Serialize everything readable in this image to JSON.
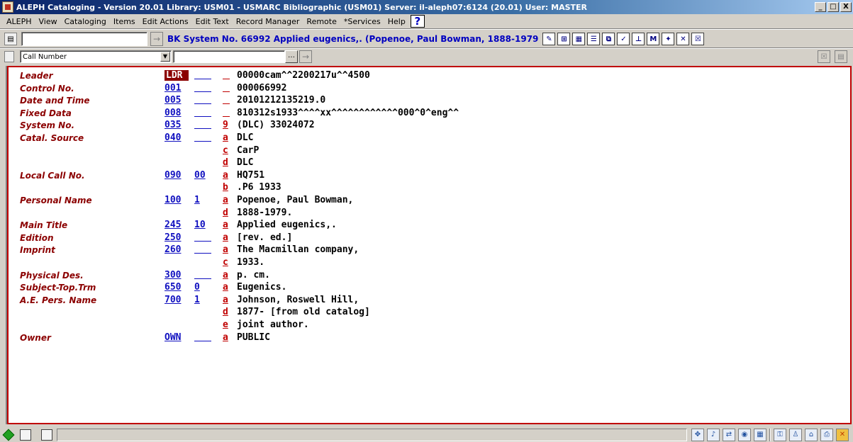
{
  "window": {
    "title": "ALEPH Cataloging - Version 20.01  Library: USM01 - USMARC Bibliographic (USM01)  Server: il-aleph07:6124 (20.01)  User: MASTER",
    "controls": [
      "_",
      "□",
      "X"
    ]
  },
  "menu": [
    "ALEPH",
    "View",
    "Cataloging",
    "Items",
    "Edit Actions",
    "Edit Text",
    "Record Manager",
    "Remote",
    "*Services",
    "Help"
  ],
  "toolbar": {
    "doc_input_value": "",
    "doc_info": "BK System No. 66992 Applied eugenics,. (Popenoe, Paul Bowman, 1888-1979"
  },
  "search": {
    "index_selected": "Call Number",
    "search_value": ""
  },
  "record": [
    {
      "label": "Leader",
      "tag": "LDR",
      "ind": "",
      "sub": "",
      "value": "00000cam^^2200217u^^4500",
      "selected": true
    },
    {
      "label": "Control No.",
      "tag": "001",
      "ind": "",
      "sub": "",
      "value": "000066992"
    },
    {
      "label": "Date and Time",
      "tag": "005",
      "ind": "",
      "sub": "",
      "value": "20101212135219.0"
    },
    {
      "label": "Fixed Data",
      "tag": "008",
      "ind": "",
      "sub": "",
      "value": "810312s1933^^^^xx^^^^^^^^^^^^000^0^eng^^"
    },
    {
      "label": "System No.",
      "tag": "035",
      "ind": "",
      "sub": "9",
      "value": "(DLC) 33024072"
    },
    {
      "label": "Catal. Source",
      "tag": "040",
      "ind": "",
      "sub": "a",
      "value": "DLC"
    },
    {
      "label": "",
      "tag": "",
      "ind": "",
      "sub": "c",
      "value": "CarP"
    },
    {
      "label": "",
      "tag": "",
      "ind": "",
      "sub": "d",
      "value": "DLC"
    },
    {
      "label": "Local Call No.",
      "tag": "090",
      "ind": "00",
      "sub": "a",
      "value": "HQ751"
    },
    {
      "label": "",
      "tag": "",
      "ind": "",
      "sub": "b",
      "value": ".P6 1933"
    },
    {
      "label": "Personal Name",
      "tag": "100",
      "ind": "1",
      "sub": "a",
      "value": "Popenoe, Paul Bowman,"
    },
    {
      "label": "",
      "tag": "",
      "ind": "",
      "sub": "d",
      "value": "1888-1979."
    },
    {
      "label": "Main Title",
      "tag": "245",
      "ind": "10",
      "sub": "a",
      "value": "Applied eugenics,."
    },
    {
      "label": "Edition",
      "tag": "250",
      "ind": "",
      "sub": "a",
      "value": "[rev. ed.]"
    },
    {
      "label": "Imprint",
      "tag": "260",
      "ind": "",
      "sub": "a",
      "value": "The Macmillan company,"
    },
    {
      "label": "",
      "tag": "",
      "ind": "",
      "sub": "c",
      "value": "1933."
    },
    {
      "label": "Physical Des.",
      "tag": "300",
      "ind": "",
      "sub": "a",
      "value": "p. cm."
    },
    {
      "label": "Subject-Top.Trm",
      "tag": "650",
      "ind": "0",
      "sub": "a",
      "value": "Eugenics."
    },
    {
      "label": "A.E. Pers. Name",
      "tag": "700",
      "ind": "1",
      "sub": "a",
      "value": "Johnson, Roswell Hill,"
    },
    {
      "label": "",
      "tag": "",
      "ind": "",
      "sub": "d",
      "value": "1877- [from old catalog]"
    },
    {
      "label": "",
      "tag": "",
      "ind": "",
      "sub": "e",
      "value": "joint author."
    },
    {
      "label": "Owner",
      "tag": "OWN",
      "ind": "",
      "sub": "a",
      "value": "PUBLIC"
    }
  ],
  "colors": {
    "title_gradient_start": "#0a246a",
    "editor_border": "#c00000",
    "label_color": "#8b0000",
    "tag_color": "#1010c0"
  }
}
